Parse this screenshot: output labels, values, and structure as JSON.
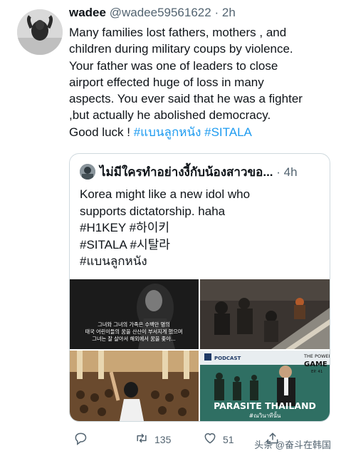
{
  "tweet": {
    "display_name": "wadee",
    "handle": "@wadee59561622",
    "separator": "·",
    "time": "2h",
    "lines": [
      "Many families lost fathers, mothers , and",
      "children during military coups by violence.",
      "Your father was one of leaders to close",
      "airport effected huge of loss in many",
      "aspects. You ever said that he was a fighter",
      ",but actually he abolished democracy."
    ],
    "last_line_text": "Good luck ! ",
    "hashtag_1": "#แบนลูกหนัง",
    "hashtag_2": "#SITALA"
  },
  "quote": {
    "display_name": "ไม่มีใครทำอย่างงี้กับน้องสาวขอ...",
    "separator": "·",
    "time": "4h",
    "lines": [
      "Korea might like a new idol who",
      "supports dictatorship. haha",
      "#H1KEY #하이키",
      "#SITALA #시탈라",
      "#แบนลูกหนัง"
    ],
    "images": {
      "img1_caption": [
        "그녀와 그녀의 가족은 수백만 명의",
        "태국 어린이들의 꿈을 산산이 부서지게 했으며",
        "그녀는 잘 살아서 해외에서 꿈을 좇아..."
      ],
      "img4_podcast": "PODCAST",
      "img4_power_line1": "THE POWER",
      "img4_power_line2": "GAME",
      "img4_ep": "EP. 41",
      "img4_title": "PARASITE THAILAND",
      "img4_subtitle": "#ณวินาทีนั้น"
    }
  },
  "actions": {
    "retweets": "135",
    "likes": "51"
  },
  "watermark": "头条 @奋斗在韩国",
  "icons": [
    "reply-icon",
    "retweet-icon",
    "like-icon",
    "share-icon"
  ],
  "colors": {
    "link": "#1d9bf0",
    "secondary": "#536471",
    "border": "#cfd9de"
  }
}
